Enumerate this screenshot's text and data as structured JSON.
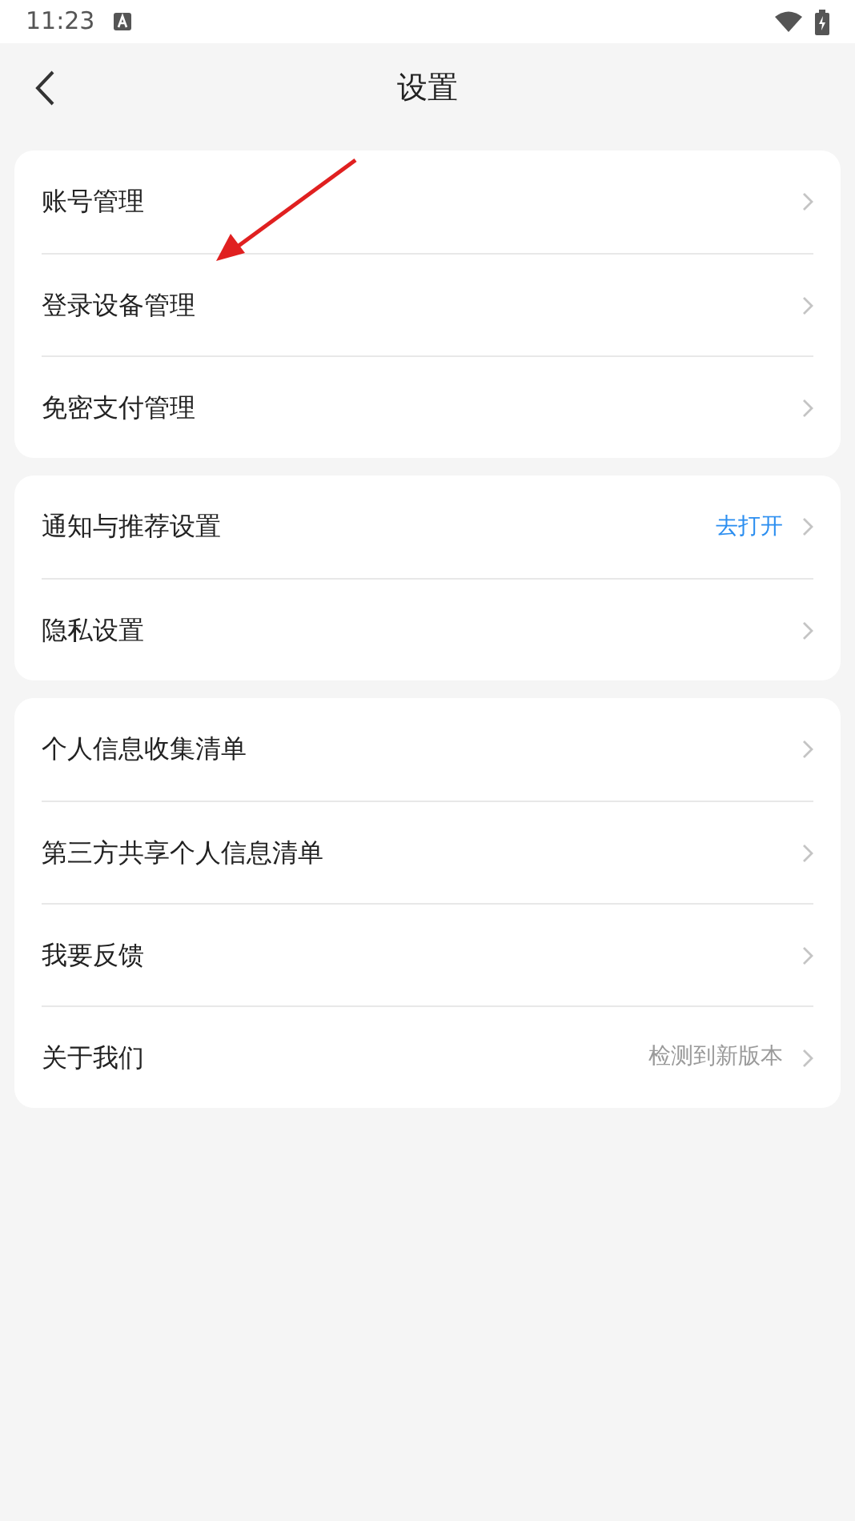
{
  "status_bar": {
    "time": "11:23"
  },
  "header": {
    "title": "设置"
  },
  "groups": [
    {
      "items": [
        {
          "label": "账号管理"
        },
        {
          "label": "登录设备管理"
        },
        {
          "label": "免密支付管理"
        }
      ]
    },
    {
      "items": [
        {
          "label": "通知与推荐设置",
          "hint": {
            "text": "去打开",
            "kind": "link"
          }
        },
        {
          "label": "隐私设置"
        }
      ]
    },
    {
      "items": [
        {
          "label": "个人信息收集清单"
        },
        {
          "label": "第三方共享个人信息清单"
        },
        {
          "label": "我要反馈"
        },
        {
          "label": "关于我们",
          "hint": {
            "text": "检测到新版本",
            "kind": "muted"
          }
        }
      ]
    }
  ]
}
